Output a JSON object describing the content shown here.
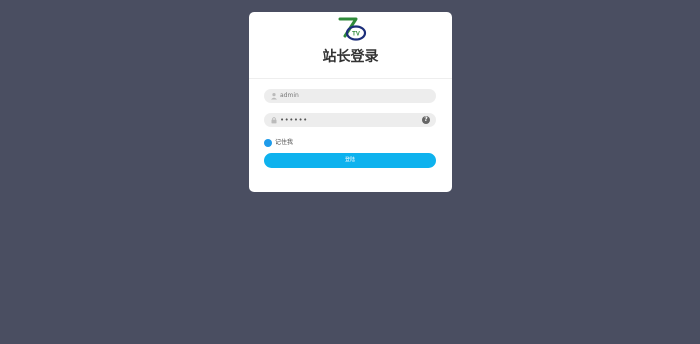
{
  "header": {
    "title": "站长登录",
    "logo_text": "TV"
  },
  "form": {
    "username_value": "admin",
    "password_value": "••••••",
    "help_glyph": "?",
    "remember_label": "记住我",
    "submit_label": "登陆"
  },
  "colors": {
    "background": "#4a4e61",
    "accent": "#0eb2ee",
    "checkbox": "#1e9bea",
    "logo_green": "#2f8a3a",
    "logo_navy": "#1c2e7a"
  },
  "icons": {
    "username": "user-icon",
    "password": "lock-icon",
    "help": "question-circle-icon",
    "remember": "checkbox-icon"
  }
}
